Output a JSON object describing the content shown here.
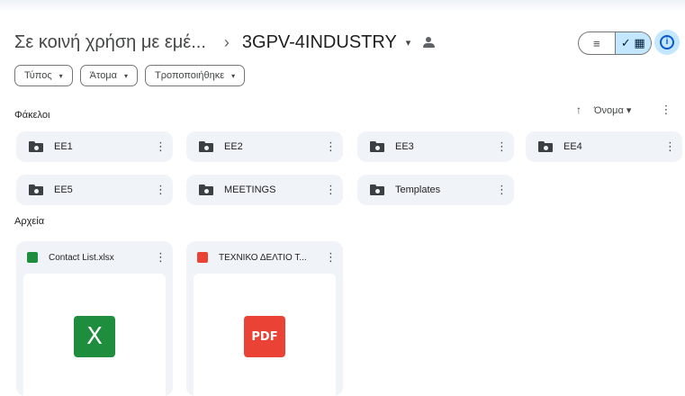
{
  "breadcrumb": {
    "parent": "Σε κοινή χρήση με εμέ...",
    "separator": "›",
    "current": "3GPV-4INDUSTRY",
    "current_caret": "▾"
  },
  "view_toggle": {
    "list_icon": "list-icon",
    "grid_icon": "grid-icon",
    "list_glyph": "≡",
    "grid_glyph": "✓ ▦",
    "selected": "grid"
  },
  "info_button": {
    "icon": "info-icon",
    "glyph": "i"
  },
  "filters": [
    {
      "label": "Τύπος",
      "caret": "▾"
    },
    {
      "label": "Άτομα",
      "caret": "▾"
    },
    {
      "label": "Τροποποιήθηκε",
      "caret": "▾"
    }
  ],
  "sections": {
    "folders_label": "Φάκελοι",
    "files_label": "Αρχεία"
  },
  "sort": {
    "arrow": "↑",
    "label": "Όνομα",
    "caret": "▾",
    "more": "⋮"
  },
  "folders": [
    {
      "name": "ΕΕ1"
    },
    {
      "name": "ΕΕ2"
    },
    {
      "name": "ΕΕ3"
    },
    {
      "name": "ΕΕ4"
    },
    {
      "name": "ΕΕ5"
    },
    {
      "name": "MEETINGS"
    },
    {
      "name": "Templates"
    }
  ],
  "files": [
    {
      "name": "Contact List.xlsx",
      "type": "spreadsheet",
      "type_glyph": "",
      "thumb_text": "X",
      "color": "#1e8e3e"
    },
    {
      "name": "ΤΕΧΝΙΚΟ ΔΕΛΤΙΟ Τ...",
      "type": "pdf",
      "type_glyph": "",
      "thumb_text": "PDF",
      "color": "#ea4335"
    }
  ],
  "kebab": "⋮",
  "colors": {
    "card_bg": "#f0f4f9",
    "accent": "#c2e7ff",
    "primary": "#0b57d0"
  }
}
